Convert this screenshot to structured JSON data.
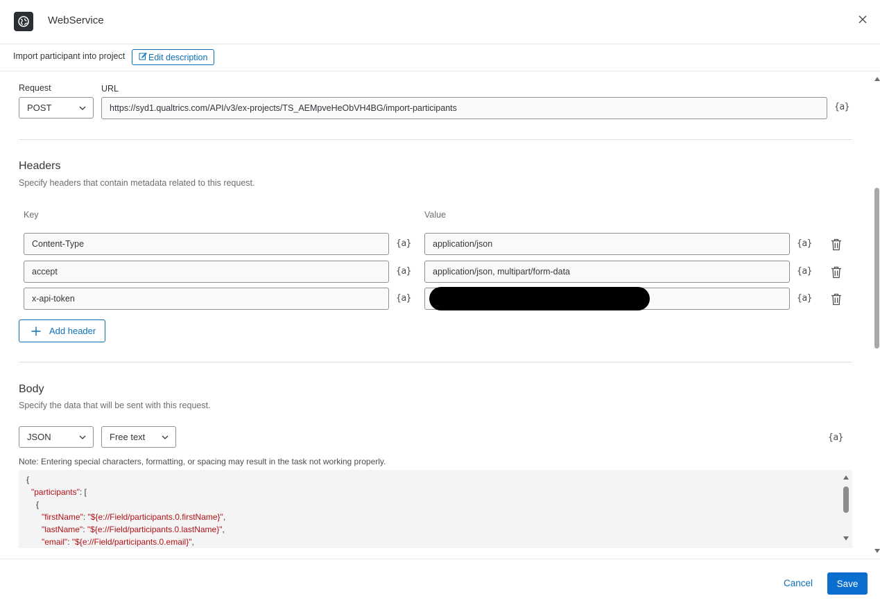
{
  "header": {
    "title": "WebService",
    "icon": "webservice-icon",
    "close_icon": "close-icon"
  },
  "description": {
    "text": "Import participant into project",
    "edit_label": "Edit description",
    "edit_icon": "edit-icon"
  },
  "request": {
    "method_label": "Request",
    "method_value": "POST",
    "url_label": "URL",
    "url_value": "https://syd1.qualtrics.com/API/v3/ex-projects/TS_AEMpveHeObVH4BG/import-participants",
    "piped_text": "{a}"
  },
  "headers_section": {
    "title": "Headers",
    "subtitle": "Specify headers that contain metadata related to this request.",
    "key_label": "Key",
    "value_label": "Value",
    "rows": [
      {
        "key": "Content-Type",
        "value": "application/json"
      },
      {
        "key": "accept",
        "value": "application/json, multipart/form-data"
      },
      {
        "key": "x-api-token",
        "value": ""
      }
    ],
    "piped_text": "{a}",
    "add_label": "Add header"
  },
  "body_section": {
    "title": "Body",
    "subtitle": "Specify the data that will be sent with this request.",
    "format_value": "JSON",
    "mode_value": "Free text",
    "piped_text": "{a}",
    "note": "Note: Entering special characters, formatting, or spacing may result in the task not working properly.",
    "code": {
      "line1": "{",
      "line2_key": "\"participants\"",
      "line2_rest": ": [",
      "line3": "{",
      "line4_key": "\"firstName\"",
      "line4_sep": ": ",
      "line4_val": "\"${e://Field/participants.0.firstName}\"",
      "line4_end": ",",
      "line5_key": "\"lastName\"",
      "line5_sep": ": ",
      "line5_val": "\"${e://Field/participants.0.lastName}\"",
      "line5_end": ",",
      "line6_key": "\"email\"",
      "line6_sep": ": ",
      "line6_val": "\"${e://Field/participants.0.email}\"",
      "line6_end": ","
    }
  },
  "footer": {
    "cancel_label": "Cancel",
    "save_label": "Save"
  },
  "colors": {
    "accent": "#0b6fb6",
    "primary_button": "#0b6fd0",
    "code_key": "#b11117"
  }
}
